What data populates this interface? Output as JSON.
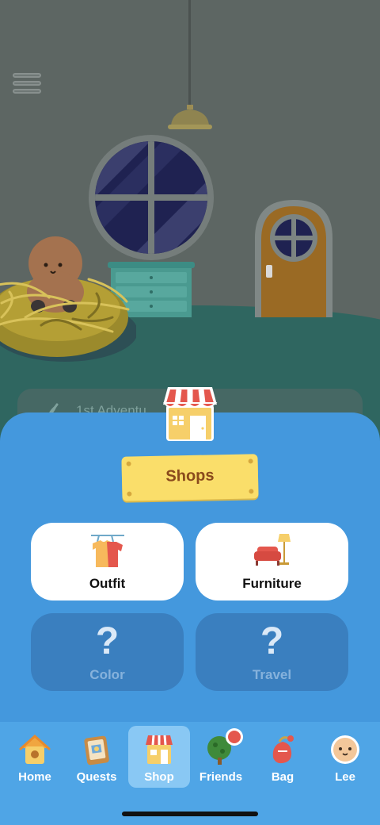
{
  "scene": {
    "adventure_text": "1st Adventu"
  },
  "shops_panel": {
    "title": "Shops",
    "cards": [
      {
        "label": "Outfit",
        "icon": "clothes-icon",
        "locked": false
      },
      {
        "label": "Furniture",
        "icon": "sofa-lamp-icon",
        "locked": false
      },
      {
        "label": "Color",
        "icon": "question-icon",
        "locked": true,
        "glyph": "?"
      },
      {
        "label": "Travel",
        "icon": "question-icon",
        "locked": true,
        "glyph": "?"
      }
    ]
  },
  "nav": {
    "items": [
      {
        "label": "Home",
        "icon": "birdhouse-icon"
      },
      {
        "label": "Quests",
        "icon": "quest-board-icon"
      },
      {
        "label": "Shop",
        "icon": "shop-icon",
        "active": true
      },
      {
        "label": "Friends",
        "icon": "tree-icon",
        "badge": true
      },
      {
        "label": "Bag",
        "icon": "bag-icon"
      },
      {
        "label": "Lee",
        "icon": "avatar-face-icon"
      }
    ]
  },
  "colors": {
    "panel": "#4498dd",
    "nav": "#4fa5e6",
    "nav_active": "#89c8f4",
    "plaque": "#fade6a",
    "plaque_text": "#8a4a1c",
    "locked_card": "#3a7fbf"
  }
}
